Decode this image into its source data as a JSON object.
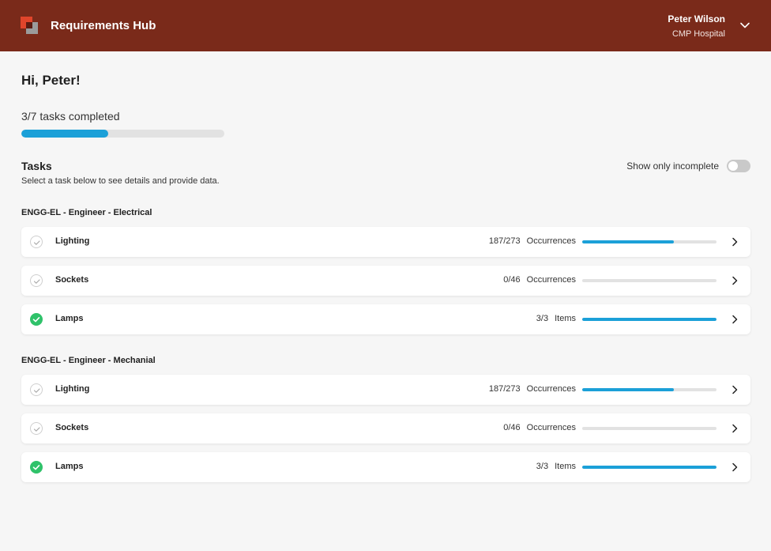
{
  "header": {
    "app_title": "Requirements Hub",
    "user_name": "Peter Wilson",
    "user_org": "CMP Hospital",
    "brand_color": "#7a2a1a"
  },
  "greeting": "Hi, Peter!",
  "progress": {
    "label": "3/7 tasks completed",
    "completed": 3,
    "total": 7,
    "color": "#1ba0d8"
  },
  "tasks_section": {
    "title": "Tasks",
    "subtitle": "Select a task below to see details and provide data.",
    "toggle_label": "Show only incomplete",
    "toggle_on": false
  },
  "groups": [
    {
      "title": "ENGG-EL - Engineer - Electrical",
      "tasks": [
        {
          "name": "Lighting",
          "count": "187/273",
          "unit": "Occurrences",
          "done": false,
          "fraction": 0.685
        },
        {
          "name": "Sockets",
          "count": "0/46",
          "unit": "Occurrences",
          "done": false,
          "fraction": 0
        },
        {
          "name": "Lamps",
          "count": "3/3",
          "unit": "Items",
          "done": true,
          "fraction": 1
        }
      ]
    },
    {
      "title": "ENGG-EL - Engineer - Mechanial",
      "tasks": [
        {
          "name": "Lighting",
          "count": "187/273",
          "unit": "Occurrences",
          "done": false,
          "fraction": 0.685
        },
        {
          "name": "Sockets",
          "count": "0/46",
          "unit": "Occurrences",
          "done": false,
          "fraction": 0
        },
        {
          "name": "Lamps",
          "count": "3/3",
          "unit": "Items",
          "done": true,
          "fraction": 1
        }
      ]
    }
  ],
  "icons": {
    "logo": "app-logo",
    "user_menu": "chevron-down-icon",
    "row_arrow": "chevron-right-icon",
    "pending": "check-circle-outline-icon",
    "done": "check-circle-filled-icon"
  },
  "colors": {
    "done_green": "#2fc26a",
    "bar_track": "#e2e2e2"
  }
}
